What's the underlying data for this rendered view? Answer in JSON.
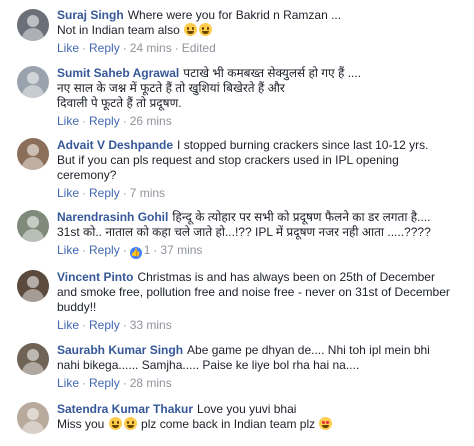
{
  "actions": {
    "like": "Like",
    "reply": "Reply",
    "sep": "·",
    "edited": "Edited"
  },
  "comments": [
    {
      "author": "Suraj Singh",
      "lines": [
        "Where were you for Bakrid n Ramzan ...",
        "Not in Indian team also"
      ],
      "time": "24 mins",
      "avatar_color": "#6a6f78"
    },
    {
      "author": "Sumit Saheb Agrawal",
      "lines": [
        "पटाखे भी कमबख्त सेक्युलर्स हो गए हैं ....",
        "नए साल के जश्न में फूटते हैं तो खुशियां बिखेरते हैं और",
        "दिवाली पे फूटते हैं तो प्रदूषण."
      ],
      "time": "26 mins",
      "avatar_color": "#9aa3ad"
    },
    {
      "author": "Advait V Deshpande",
      "lines": [
        "I stopped burning crackers since last 10-12 yrs.",
        "But if you can pls request and stop crackers used in IPL opening",
        "ceremony?"
      ],
      "time": "7 mins",
      "avatar_color": "#8c6f5a"
    },
    {
      "author": "Narendrasinh Gohil",
      "lines": [
        "हिन्दू के त्योहार पर सभी को प्रदूषण फैलने का डर लगता है....",
        "31st को.. नाताल को कहा चले जाते हो...!?? IPL में प्रदूषण नजर नही आता .....????"
      ],
      "reaction_count": "1",
      "time": "37 mins",
      "avatar_color": "#7f8a7a"
    },
    {
      "author": "Vincent Pinto",
      "lines": [
        "Christmas is and has always been on 25th of December",
        "and smoke free, pollution free and noise free - never on 31st of December",
        "buddy!!"
      ],
      "time": "33 mins",
      "avatar_color": "#5b4b3e"
    },
    {
      "author": "Saurabh Kumar Singh",
      "lines": [
        "Abe game pe dhyan de.... Nhi toh ipl mein bhi",
        "nahi bikega...... Samjha..... Paise ke liye bol rha hai na...."
      ],
      "time": "28 mins",
      "avatar_color": "#6f6356"
    },
    {
      "author": "Satendra Kumar Thakur",
      "lines": [
        "Love you yuvi bhai",
        "Miss you",
        "plz come back in Indian team plz"
      ],
      "avatar_color": "#b8aa9c"
    }
  ]
}
